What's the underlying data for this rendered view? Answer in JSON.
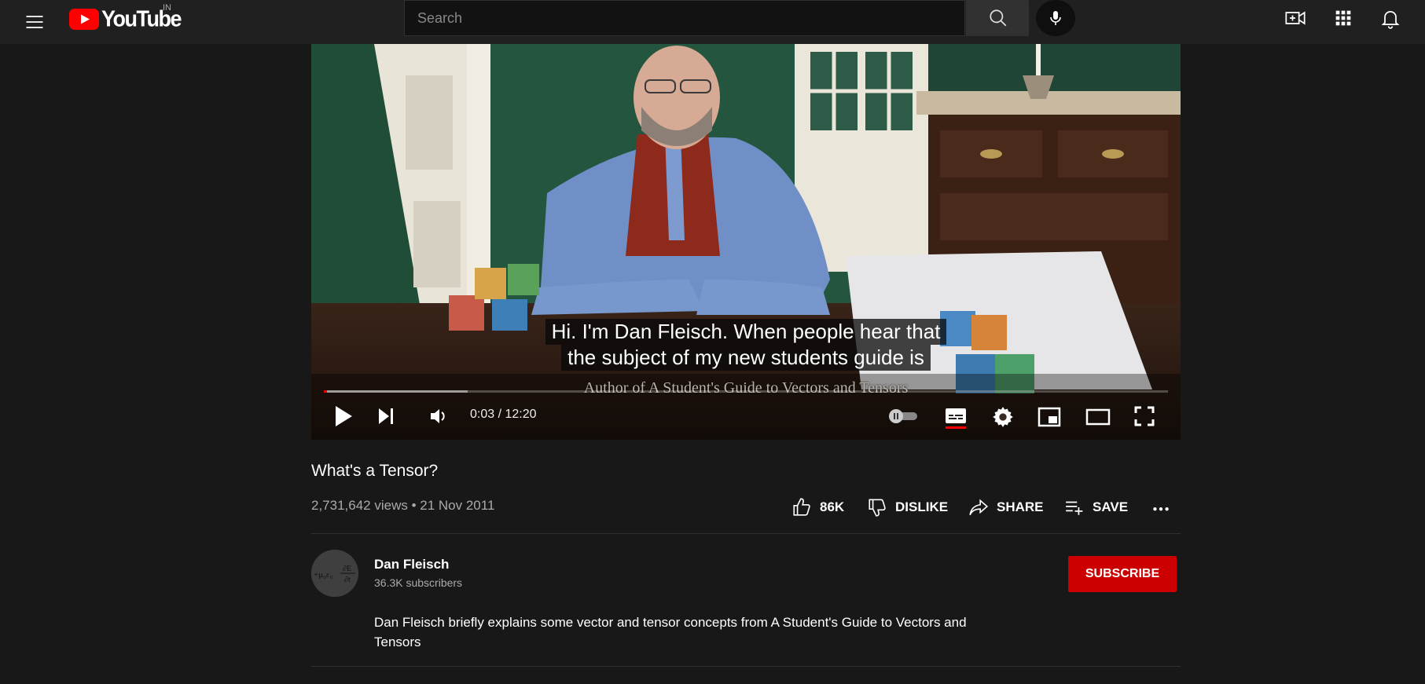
{
  "header": {
    "logo_text": "YouTube",
    "country_code": "IN",
    "search_placeholder": "Search",
    "icons": [
      "menu-icon",
      "search-icon",
      "mic-icon",
      "create-video-icon",
      "apps-grid-icon",
      "notifications-bell-icon"
    ]
  },
  "player": {
    "caption_lines": [
      "Hi.  I'm Dan Fleisch.  When people hear that",
      "the subject of my new students guide is"
    ],
    "video_credit": "Author of A Student's Guide to Vectors and Tensors",
    "current_time": "0:03",
    "duration": "12:20",
    "time_display": "0:03 / 12:20",
    "played_fraction": 0.004,
    "buffered_fraction": 0.17,
    "autoplay_on": false,
    "captions_on": true,
    "accent_color": "#ff0000",
    "controls": [
      "play-icon",
      "next-icon",
      "volume-icon",
      "autoplay-toggle",
      "subtitles-icon",
      "settings-gear-icon",
      "miniplayer-icon",
      "theater-mode-icon",
      "fullscreen-icon"
    ]
  },
  "video": {
    "title": "What's a Tensor?",
    "meta": "2,731,642 views • 21 Nov 2011",
    "actions": {
      "like_label": "86K",
      "dislike_label": "DISLIKE",
      "share_label": "SHARE",
      "save_label": "SAVE"
    }
  },
  "channel": {
    "name": "Dan Fleisch",
    "subscribers": "36.3K subscribers",
    "subscribe_label": "SUBSCRIBE",
    "subscribe_color": "#cc0000",
    "description": "Dan Fleisch briefly explains some vector and tensor concepts from A Student's Guide to Vectors and Tensors"
  }
}
